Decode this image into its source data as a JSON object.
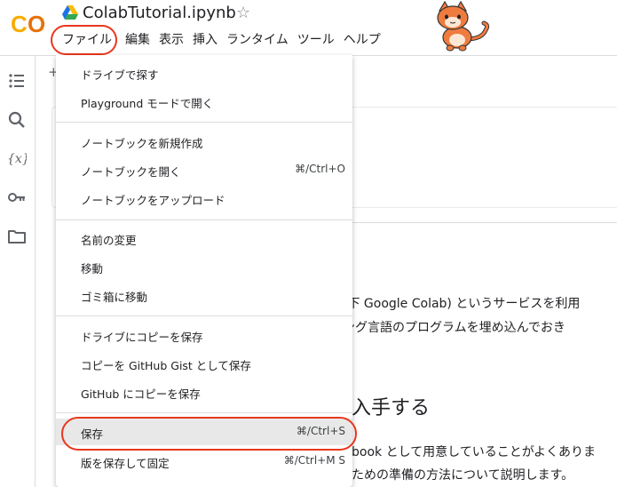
{
  "app": {
    "logo_text": "CO",
    "title": "ColabTutorial.ipynb",
    "star_glyph": "☆"
  },
  "menubar": [
    {
      "label": "ファイル"
    },
    {
      "label": "編集"
    },
    {
      "label": "表示"
    },
    {
      "label": "挿入"
    },
    {
      "label": "ランタイム"
    },
    {
      "label": "ツール"
    },
    {
      "label": "ヘルプ"
    }
  ],
  "file_menu": {
    "items": [
      {
        "label": "ドライブで探す",
        "shortcut": ""
      },
      {
        "label": "Playground モードで開く",
        "shortcut": ""
      },
      {
        "label": "ノートブックを新規作成",
        "shortcut": ""
      },
      {
        "label": "ノートブックを開く",
        "shortcut": "⌘/Ctrl+O"
      },
      {
        "label": "ノートブックをアップロード",
        "shortcut": ""
      },
      {
        "label": "名前の変更",
        "shortcut": ""
      },
      {
        "label": "移動",
        "shortcut": ""
      },
      {
        "label": "ゴミ箱に移動",
        "shortcut": ""
      },
      {
        "label": "ドライブにコピーを保存",
        "shortcut": ""
      },
      {
        "label": "コピーを GitHub Gist として保存",
        "shortcut": ""
      },
      {
        "label": "GitHub にコピーを保存",
        "shortcut": ""
      },
      {
        "label": "保存",
        "shortcut": "⌘/Ctrl+S",
        "highlighted": true
      },
      {
        "label": "版を保存して固定",
        "shortcut": "⌘/Ctrl+M S"
      }
    ]
  },
  "notebook": {
    "plus_frag": "+",
    "line1": "(以下 Google Colab) というサービスを利用",
    "line2": "ミング言語のプログラムを埋め込んでおき",
    "heading": "入手する",
    "line3": "book として用意していることがよくありま",
    "line4": "ための準備の方法について説明します。"
  },
  "colors": {
    "accent_orange": "#f9ab00",
    "annotation_red": "#e8371d",
    "highlight_gray": "#e8e8e8",
    "divider": "#dadce0"
  },
  "icons": [
    "toc-icon",
    "search-icon",
    "variables-icon",
    "key-icon",
    "folder-icon",
    "drive-icon",
    "star-icon"
  ]
}
